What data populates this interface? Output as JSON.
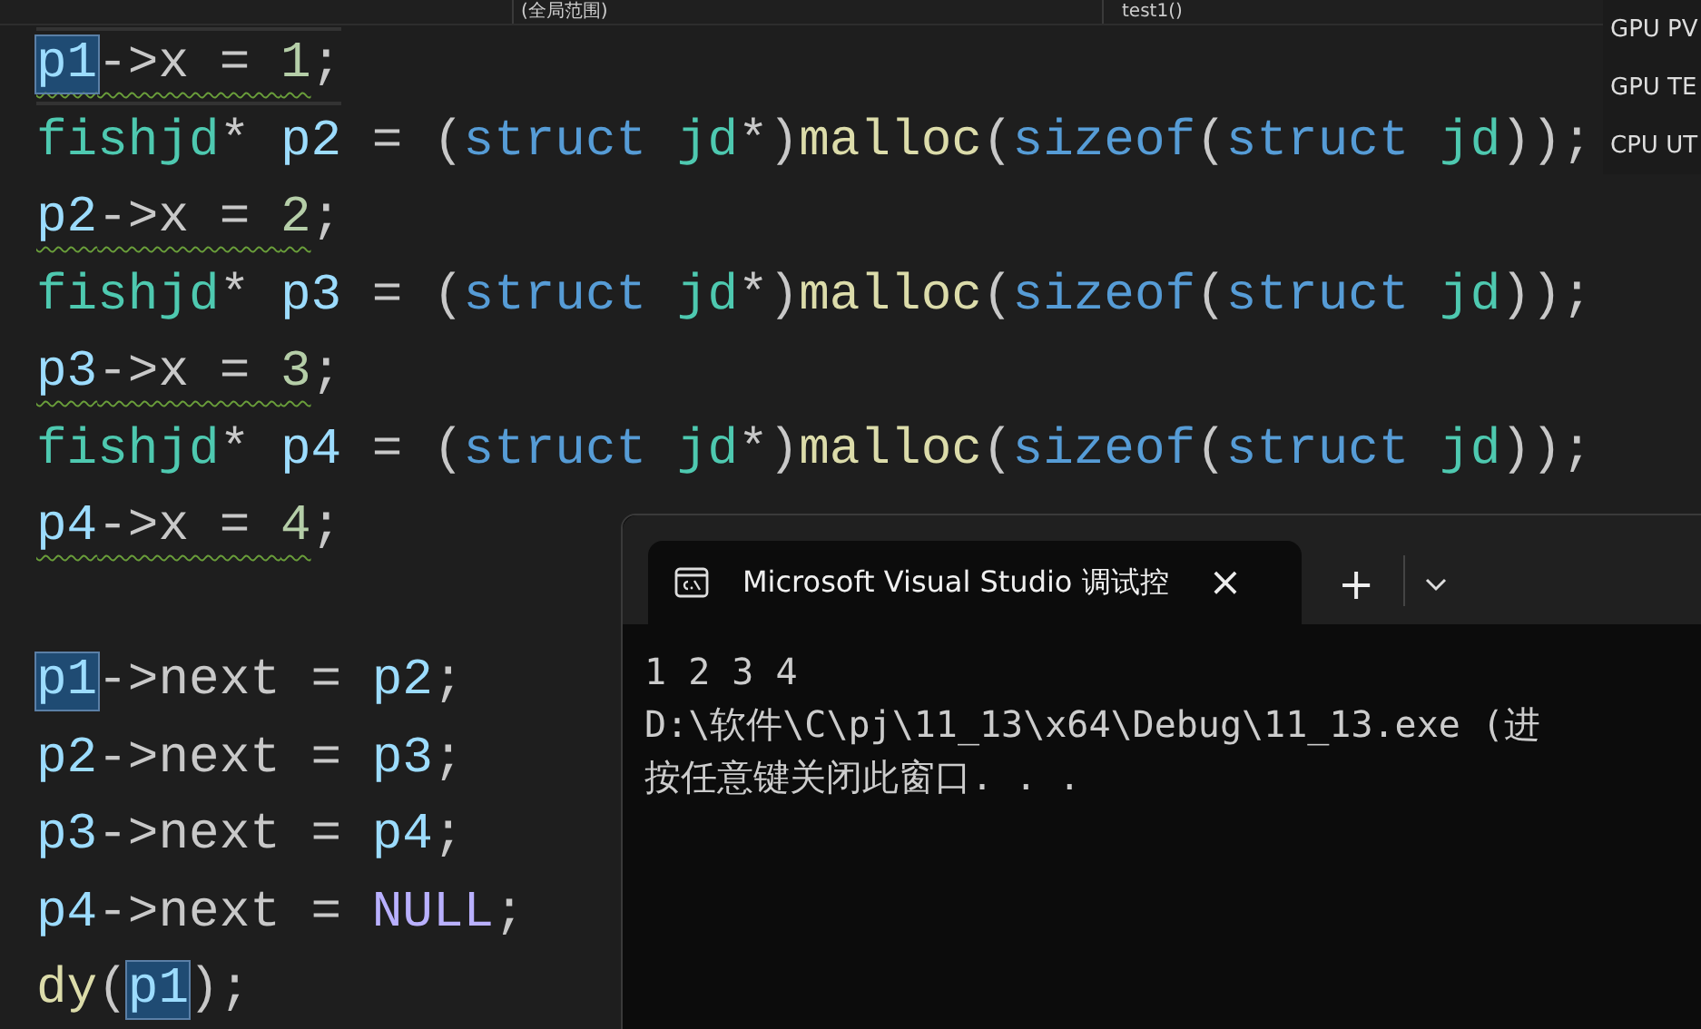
{
  "nav_bar": {
    "scope": "(全局范围)",
    "function": "test1()"
  },
  "perf_panel": {
    "labels": [
      "GPU PV",
      "GPU TE",
      "CPU UT"
    ]
  },
  "editor": {
    "lines": [
      {
        "kind": "code",
        "warning": true,
        "current": true,
        "tokens": [
          {
            "text": "p1",
            "kind": "var",
            "highlighted": true
          },
          {
            "text": "->x = ",
            "kind": "op",
            "highlighted": false
          },
          {
            "text": "1",
            "kind": "num",
            "highlighted": false
          },
          {
            "text": ";",
            "kind": "op",
            "highlighted": false
          }
        ]
      },
      {
        "kind": "code",
        "warning": false,
        "current": false,
        "tokens": [
          {
            "text": "fishjd",
            "kind": "type",
            "highlighted": false
          },
          {
            "text": "* ",
            "kind": "op",
            "highlighted": false
          },
          {
            "text": "p2",
            "kind": "var",
            "highlighted": false
          },
          {
            "text": " = (",
            "kind": "op",
            "highlighted": false
          },
          {
            "text": "struct",
            "kind": "kw",
            "highlighted": false
          },
          {
            "text": " jd",
            "kind": "type",
            "highlighted": false
          },
          {
            "text": "*)",
            "kind": "op",
            "highlighted": false
          },
          {
            "text": "malloc",
            "kind": "fn",
            "highlighted": false
          },
          {
            "text": "(",
            "kind": "op",
            "highlighted": false
          },
          {
            "text": "sizeof",
            "kind": "kw",
            "highlighted": false
          },
          {
            "text": "(",
            "kind": "op",
            "highlighted": false
          },
          {
            "text": "struct",
            "kind": "kw",
            "highlighted": false
          },
          {
            "text": " jd",
            "kind": "type",
            "highlighted": false
          },
          {
            "text": "));",
            "kind": "op",
            "highlighted": false
          }
        ]
      },
      {
        "kind": "code",
        "warning": true,
        "current": false,
        "tokens": [
          {
            "text": "p2",
            "kind": "var",
            "highlighted": false
          },
          {
            "text": "->x = ",
            "kind": "op",
            "highlighted": false
          },
          {
            "text": "2",
            "kind": "num",
            "highlighted": false
          },
          {
            "text": ";",
            "kind": "op",
            "highlighted": false
          }
        ]
      },
      {
        "kind": "code",
        "warning": false,
        "current": false,
        "tokens": [
          {
            "text": "fishjd",
            "kind": "type",
            "highlighted": false
          },
          {
            "text": "* ",
            "kind": "op",
            "highlighted": false
          },
          {
            "text": "p3",
            "kind": "var",
            "highlighted": false
          },
          {
            "text": " = (",
            "kind": "op",
            "highlighted": false
          },
          {
            "text": "struct",
            "kind": "kw",
            "highlighted": false
          },
          {
            "text": " jd",
            "kind": "type",
            "highlighted": false
          },
          {
            "text": "*)",
            "kind": "op",
            "highlighted": false
          },
          {
            "text": "malloc",
            "kind": "fn",
            "highlighted": false
          },
          {
            "text": "(",
            "kind": "op",
            "highlighted": false
          },
          {
            "text": "sizeof",
            "kind": "kw",
            "highlighted": false
          },
          {
            "text": "(",
            "kind": "op",
            "highlighted": false
          },
          {
            "text": "struct",
            "kind": "kw",
            "highlighted": false
          },
          {
            "text": " jd",
            "kind": "type",
            "highlighted": false
          },
          {
            "text": "));",
            "kind": "op",
            "highlighted": false
          }
        ]
      },
      {
        "kind": "code",
        "warning": true,
        "current": false,
        "tokens": [
          {
            "text": "p3",
            "kind": "var",
            "highlighted": false
          },
          {
            "text": "->x = ",
            "kind": "op",
            "highlighted": false
          },
          {
            "text": "3",
            "kind": "num",
            "highlighted": false
          },
          {
            "text": ";",
            "kind": "op",
            "highlighted": false
          }
        ]
      },
      {
        "kind": "code",
        "warning": false,
        "current": false,
        "tokens": [
          {
            "text": "fishjd",
            "kind": "type",
            "highlighted": false
          },
          {
            "text": "* ",
            "kind": "op",
            "highlighted": false
          },
          {
            "text": "p4",
            "kind": "var",
            "highlighted": false
          },
          {
            "text": " = (",
            "kind": "op",
            "highlighted": false
          },
          {
            "text": "struct",
            "kind": "kw",
            "highlighted": false
          },
          {
            "text": " jd",
            "kind": "type",
            "highlighted": false
          },
          {
            "text": "*)",
            "kind": "op",
            "highlighted": false
          },
          {
            "text": "malloc",
            "kind": "fn",
            "highlighted": false
          },
          {
            "text": "(",
            "kind": "op",
            "highlighted": false
          },
          {
            "text": "sizeof",
            "kind": "kw",
            "highlighted": false
          },
          {
            "text": "(",
            "kind": "op",
            "highlighted": false
          },
          {
            "text": "struct",
            "kind": "kw",
            "highlighted": false
          },
          {
            "text": " jd",
            "kind": "type",
            "highlighted": false
          },
          {
            "text": "));",
            "kind": "op",
            "highlighted": false
          }
        ]
      },
      {
        "kind": "code",
        "warning": true,
        "current": false,
        "tokens": [
          {
            "text": "p4",
            "kind": "var",
            "highlighted": false
          },
          {
            "text": "->x = ",
            "kind": "op",
            "highlighted": false
          },
          {
            "text": "4",
            "kind": "num",
            "highlighted": false
          },
          {
            "text": ";",
            "kind": "op",
            "highlighted": false
          }
        ]
      },
      {
        "kind": "blank"
      },
      {
        "kind": "code",
        "warning": false,
        "current": false,
        "tokens": [
          {
            "text": "p1",
            "kind": "var",
            "highlighted": true
          },
          {
            "text": "->next = ",
            "kind": "op",
            "highlighted": false
          },
          {
            "text": "p2",
            "kind": "var",
            "highlighted": false
          },
          {
            "text": ";",
            "kind": "op",
            "highlighted": false
          }
        ]
      },
      {
        "kind": "code",
        "warning": false,
        "current": false,
        "tokens": [
          {
            "text": "p2",
            "kind": "var",
            "highlighted": false
          },
          {
            "text": "->next = ",
            "kind": "op",
            "highlighted": false
          },
          {
            "text": "p3",
            "kind": "var",
            "highlighted": false
          },
          {
            "text": ";",
            "kind": "op",
            "highlighted": false
          }
        ]
      },
      {
        "kind": "code",
        "warning": false,
        "current": false,
        "tokens": [
          {
            "text": "p3",
            "kind": "var",
            "highlighted": false
          },
          {
            "text": "->next = ",
            "kind": "op",
            "highlighted": false
          },
          {
            "text": "p4",
            "kind": "var",
            "highlighted": false
          },
          {
            "text": ";",
            "kind": "op",
            "highlighted": false
          }
        ]
      },
      {
        "kind": "code",
        "warning": false,
        "current": false,
        "tokens": [
          {
            "text": "p4",
            "kind": "var",
            "highlighted": false
          },
          {
            "text": "->next = ",
            "kind": "op",
            "highlighted": false
          },
          {
            "text": "NULL",
            "kind": "macro",
            "highlighted": false
          },
          {
            "text": ";",
            "kind": "op",
            "highlighted": false
          }
        ]
      },
      {
        "kind": "code",
        "warning": false,
        "current": false,
        "tokens": [
          {
            "text": "dy",
            "kind": "fn",
            "highlighted": false
          },
          {
            "text": "(",
            "kind": "op",
            "highlighted": false
          },
          {
            "text": "p1",
            "kind": "var",
            "highlighted": true
          },
          {
            "text": ");",
            "kind": "op",
            "highlighted": false
          }
        ]
      }
    ]
  },
  "console": {
    "tab_title": "Microsoft Visual Studio 调试控",
    "close": "×",
    "new_tab": "+",
    "output": [
      "1 2 3 4",
      "D:\\软件\\C\\pj\\11_13\\x64\\Debug\\11_13.exe (进",
      "按任意键关闭此窗口. . ."
    ]
  }
}
